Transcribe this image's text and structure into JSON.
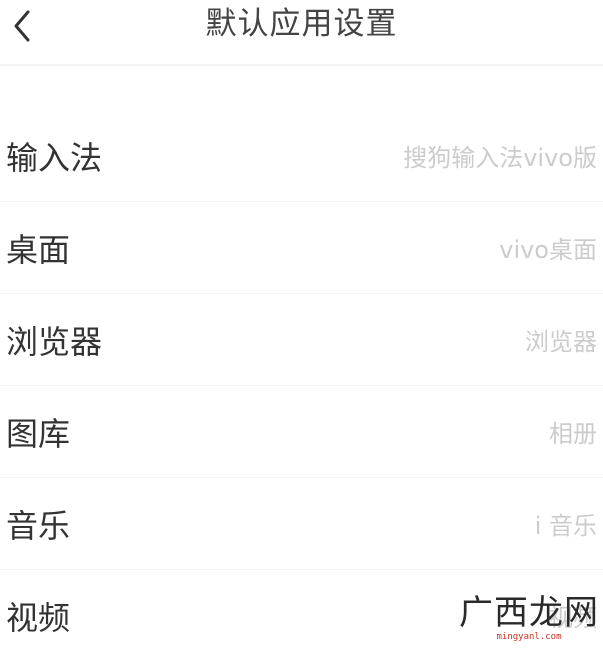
{
  "header": {
    "title": "默认应用设置",
    "back_icon": "chevron-left-icon"
  },
  "items": [
    {
      "label": "输入法",
      "value": "搜狗输入法vivo版"
    },
    {
      "label": "桌面",
      "value": "vivo桌面"
    },
    {
      "label": "浏览器",
      "value": "浏览器"
    },
    {
      "label": "图库",
      "value": "相册"
    },
    {
      "label": "音乐",
      "value": "i 音乐"
    },
    {
      "label": "视频",
      "value": "视频"
    }
  ],
  "watermark": {
    "text": "广西龙网",
    "url": "mingyanl.com"
  },
  "colors": {
    "background": "#ffffff",
    "label": "#333333",
    "value": "#cccccc",
    "divider": "#f5f5f5"
  }
}
